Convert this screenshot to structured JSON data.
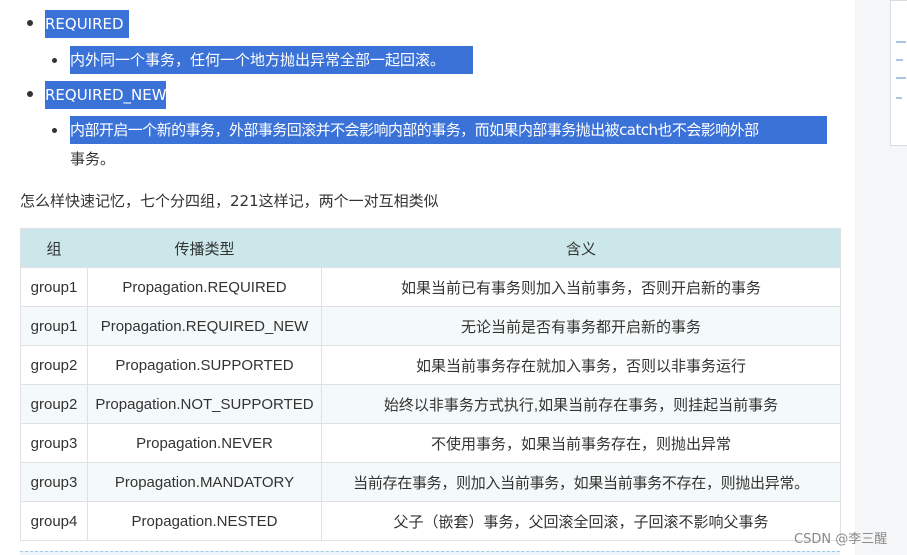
{
  "list": {
    "item1": {
      "label": "REQUIRED",
      "sub": "内外同一个事务，任何一个地方抛出异常全部一起回滚。"
    },
    "item2": {
      "label": "REQUIRED_NEW",
      "sub_line1": "内部开启一个新的事务，外部事务回滚并不会影响内部的事务，而如果内部事务抛出被catch也不会影响外部",
      "sub_line2": "事务。"
    }
  },
  "paragraph": "怎么样快速记忆，七个分四组，221这样记，两个一对互相类似",
  "table": {
    "headers": [
      "组",
      "传播类型",
      "含义"
    ],
    "rows": [
      [
        "group1",
        "Propagation.REQUIRED",
        "如果当前已有事务则加入当前事务，否则开启新的事务"
      ],
      [
        "group1",
        "Propagation.REQUIRED_NEW",
        "无论当前是否有事务都开启新的事务"
      ],
      [
        "group2",
        "Propagation.SUPPORTED",
        "如果当前事务存在就加入事务，否则以非事务运行"
      ],
      [
        "group2",
        "Propagation.NOT_SUPPORTED",
        "始终以非事务方式执行,如果当前存在事务，则挂起当前事务"
      ],
      [
        "group3",
        "Propagation.NEVER",
        "不使用事务，如果当前事务存在，则抛出异常"
      ],
      [
        "group3",
        "Propagation.MANDATORY",
        "当前存在事务，则加入当前事务，如果当前事务不存在，则抛出异常。"
      ],
      [
        "group4",
        "Propagation.NESTED",
        "父子（嵌套）事务，父回滚全回滚，子回滚不影响父事务"
      ]
    ]
  },
  "watermark": "CSDN @李三醒",
  "colors": {
    "selection": "#3a72d8",
    "table_header": "#cce7ea",
    "row_alt": "#f4fafa"
  }
}
